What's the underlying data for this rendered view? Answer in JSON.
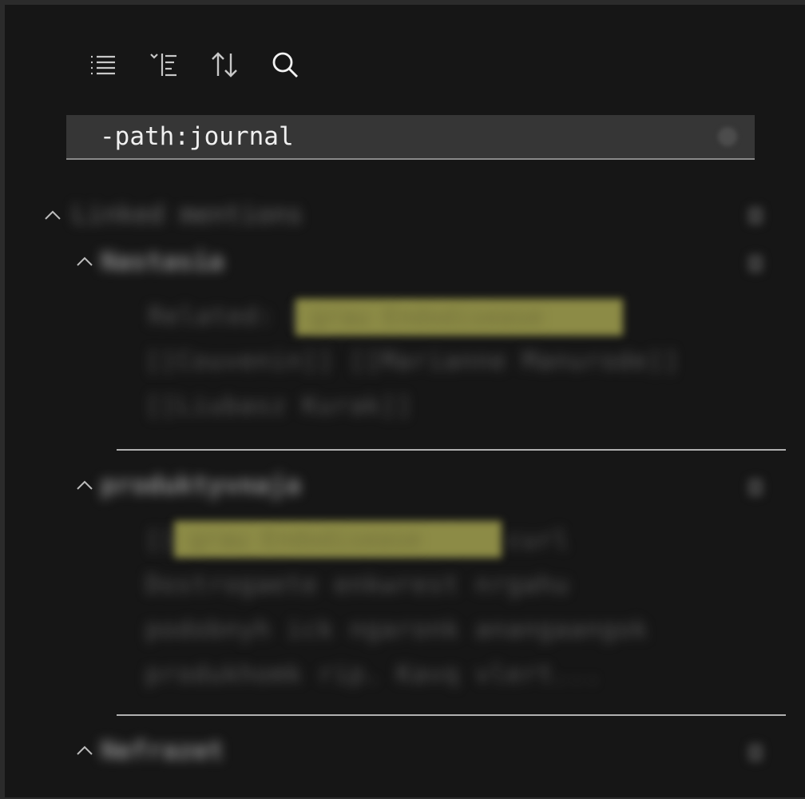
{
  "toolbar": {
    "buttons": [
      {
        "name": "collapse-all-button",
        "icon": "list-icon"
      },
      {
        "name": "show-more-context-button",
        "icon": "filter-lines-icon"
      },
      {
        "name": "change-sort-button",
        "icon": "sort-arrows-icon"
      },
      {
        "name": "toggle-search-settings-button",
        "icon": "search-icon"
      }
    ]
  },
  "search": {
    "query": "-path:journal"
  },
  "results": {
    "group_title": "Linked mentions",
    "files": [
      {
        "title": "Nastasia",
        "lines": [
          "Related: [[grau Endodisease",
          "[[Couvenin]] [[Marianne Manurode]]",
          "[[Liubasz Kurak]]"
        ],
        "highlight": "grau Endodisease"
      },
      {
        "title": "produktyvnaja",
        "lines": [
          "[[grau Endodisease]] - curl",
          "Dostrogaete enkwrest nrgahu",
          "podobnyh ick ngaronk anangaangok",
          "produkhomk rip. Kavq vlert..."
        ],
        "highlight": "grau Endodisease"
      },
      {
        "title": "Nefrazet",
        "lines": []
      }
    ]
  }
}
